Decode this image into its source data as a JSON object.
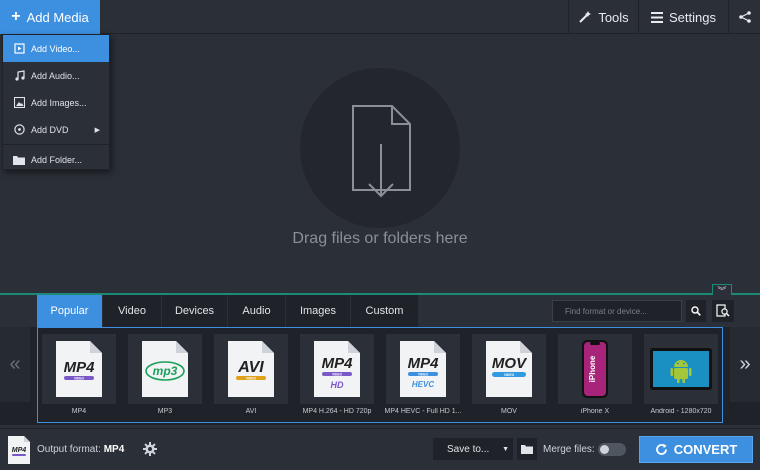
{
  "topbar": {
    "add_media_label": "Add Media",
    "tools_label": "Tools",
    "settings_label": "Settings",
    "icons": [
      "plus-icon",
      "magic-wand-icon",
      "hamburger-icon",
      "share-icon"
    ]
  },
  "menu": {
    "items": [
      {
        "label": "Add Video...",
        "icon": "video-file-icon",
        "active": true
      },
      {
        "label": "Add Audio...",
        "icon": "music-note-icon",
        "active": false
      },
      {
        "label": "Add Images...",
        "icon": "image-icon",
        "active": false
      },
      {
        "label": "Add DVD",
        "icon": "disc-icon",
        "active": false
      },
      {
        "label": "Add Folder...",
        "icon": "folder-icon",
        "active": false
      }
    ]
  },
  "drop": {
    "text": "Drag files or folders here"
  },
  "tabs": [
    {
      "label": "Popular",
      "active": true
    },
    {
      "label": "Video",
      "active": false
    },
    {
      "label": "Devices",
      "active": false
    },
    {
      "label": "Audio",
      "active": false
    },
    {
      "label": "Images",
      "active": false
    },
    {
      "label": "Custom",
      "active": false
    }
  ],
  "search": {
    "placeholder": "Find format or device..."
  },
  "formats": [
    {
      "label": "MP4",
      "tag": "MP4",
      "sub": "VIDEO"
    },
    {
      "label": "MP3",
      "tag": "mp3",
      "sub": ""
    },
    {
      "label": "AVI",
      "tag": "AVI",
      "sub": "VIDEO"
    },
    {
      "label": "MP4 H.264 - HD 720p",
      "tag": "MP4",
      "sub": "VIDEO",
      "extra": "HD"
    },
    {
      "label": "MP4 HEVC - Full HD 1...",
      "tag": "MP4",
      "sub": "VIDEO",
      "extra": "HEVC"
    },
    {
      "label": "MOV",
      "tag": "MOV",
      "sub": "VIDEO"
    },
    {
      "label": "iPhone X",
      "tag": "iPhone",
      "sub": ""
    },
    {
      "label": "Android - 1280x720",
      "tag": "",
      "sub": ""
    }
  ],
  "bottombar": {
    "output_prefix": "Output format:",
    "output_value": "MP4",
    "save_to_label": "Save to...",
    "merge_label": "Merge files:",
    "convert_label": "CONVERT"
  },
  "colors": {
    "accent": "#3d8fe0",
    "panel_line": "#1c8a76",
    "background": "#2b2f37"
  }
}
